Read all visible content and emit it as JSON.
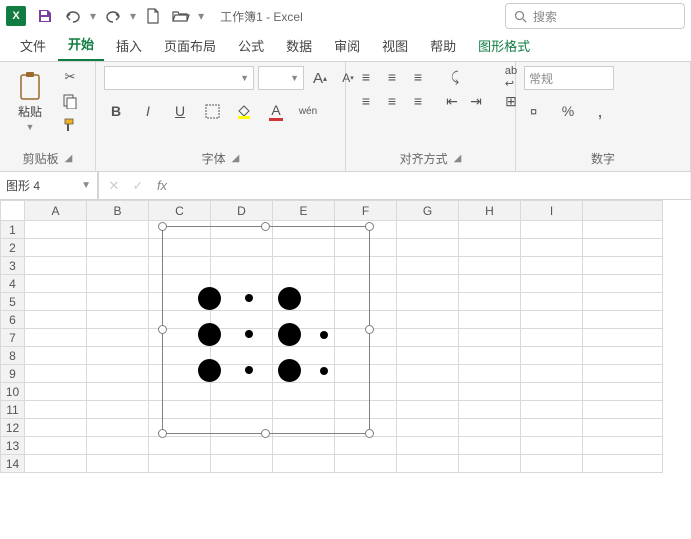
{
  "app": {
    "title": "工作簿1  -  Excel",
    "search_placeholder": "搜索"
  },
  "qat": {
    "save": "save",
    "undo": "undo",
    "redo": "redo",
    "new": "new",
    "open": "open"
  },
  "tabs": {
    "file": "文件",
    "home": "开始",
    "insert": "插入",
    "layout": "页面布局",
    "formulas": "公式",
    "data": "数据",
    "review": "审阅",
    "view": "视图",
    "help": "帮助",
    "shapeformat": "图形格式"
  },
  "ribbon": {
    "clipboard": {
      "paste": "粘贴",
      "group": "剪贴板"
    },
    "font": {
      "group": "字体",
      "bold": "B",
      "italic": "I",
      "underline": "U",
      "wen": "wén"
    },
    "alignment": {
      "group": "对齐方式"
    },
    "number": {
      "group": "数字",
      "format": "常规",
      "percent": "%"
    }
  },
  "namebox": {
    "value": "图形 4"
  },
  "formula": {
    "fx": "fx"
  },
  "grid": {
    "cols": [
      "A",
      "B",
      "C",
      "D",
      "E",
      "F",
      "G",
      "H",
      "I"
    ],
    "rows": [
      "1",
      "2",
      "3",
      "4",
      "5",
      "6",
      "7",
      "8",
      "9",
      "10",
      "11",
      "12",
      "13",
      "14"
    ]
  }
}
